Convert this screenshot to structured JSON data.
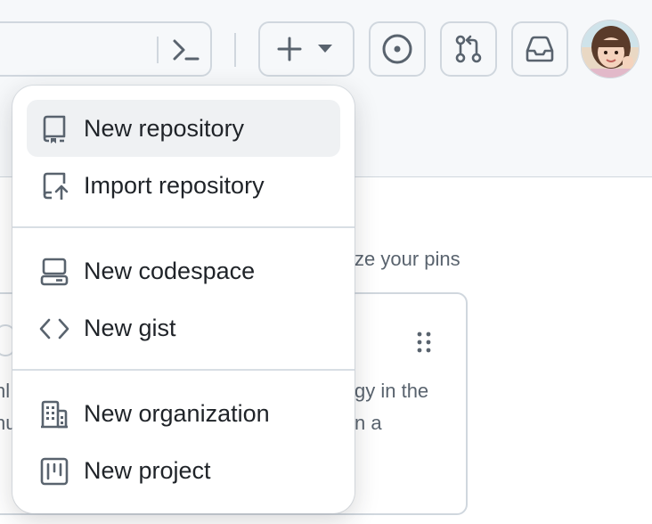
{
  "header": {
    "create_button": {
      "plus_icon": "plus-icon",
      "caret_icon": "triangle-down-icon"
    },
    "buttons": [
      "issues-icon",
      "pull-request-icon",
      "inbox-icon"
    ],
    "avatar": "user-avatar"
  },
  "background": {
    "pins_hint": "ze your pins",
    "card_right_line1": "gy in the",
    "card_right_line2": "n a",
    "card_left_line1": "hl",
    "card_left_line2": "nu",
    "card_left_line3": "·  "
  },
  "menu": {
    "items": [
      {
        "label": "New repository",
        "icon": "repo-icon"
      },
      {
        "label": "Import repository",
        "icon": "repo-push-icon"
      },
      {
        "label": "New codespace",
        "icon": "codespaces-icon"
      },
      {
        "label": "New gist",
        "icon": "code-icon"
      },
      {
        "label": "New organization",
        "icon": "organization-icon"
      },
      {
        "label": "New project",
        "icon": "project-icon"
      }
    ]
  },
  "colors": {
    "accent": "#1f2328",
    "muted": "#59636e",
    "border": "#d0d7de",
    "hover": "#eff1f3"
  }
}
